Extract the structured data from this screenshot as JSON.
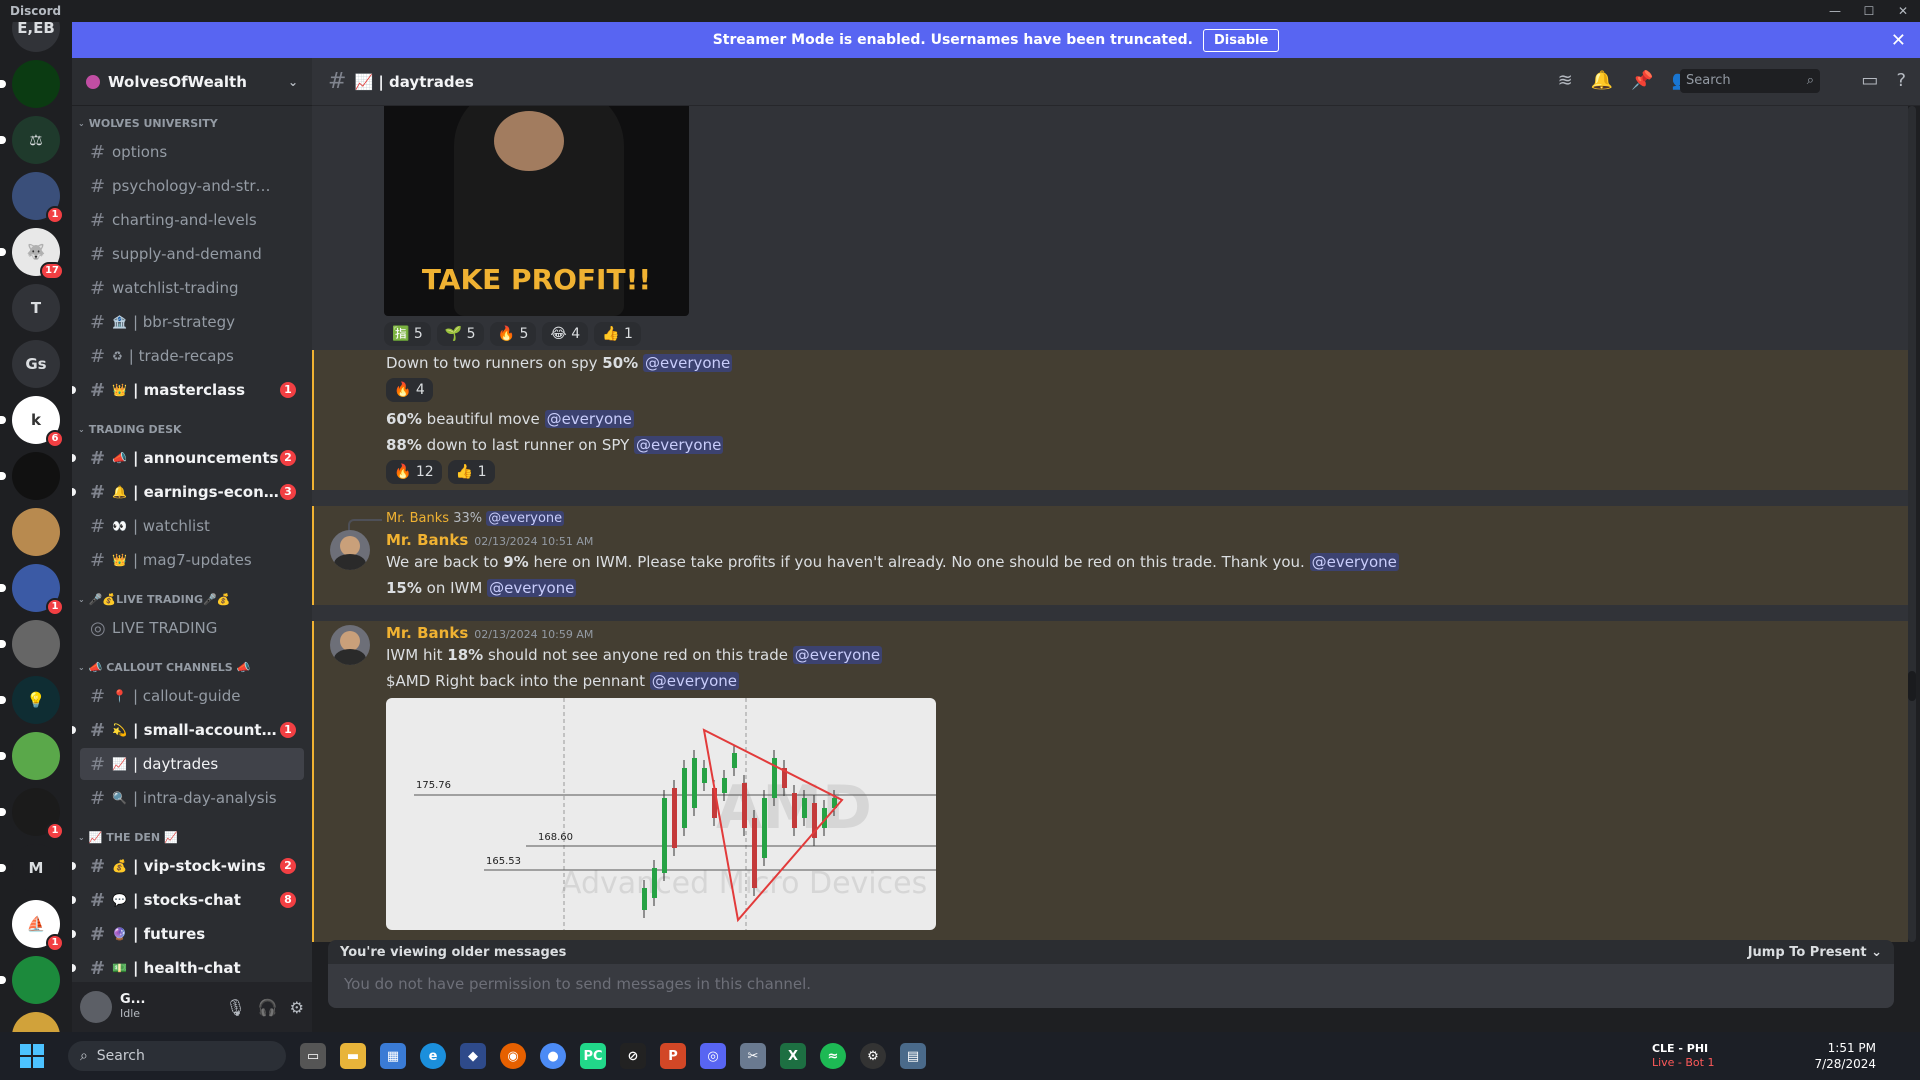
{
  "titlebar": {
    "app": "Discord",
    "minimize": "—",
    "maximize": "☐",
    "close": "✕"
  },
  "servers": [
    {
      "label": "E,EB",
      "color": "#313338",
      "pill": false,
      "count": ""
    },
    {
      "label": "",
      "color": "#0b3b12",
      "pill": true,
      "count": ""
    },
    {
      "label": "⚖",
      "color": "#1f3a2c",
      "pill": true,
      "count": ""
    },
    {
      "label": "",
      "color": "#3a4f7a",
      "pill": false,
      "count": "1"
    },
    {
      "label": "🐺",
      "color": "#e8e8e8",
      "pill": true,
      "count": "17"
    },
    {
      "label": "T",
      "color": "#313338",
      "pill": false,
      "count": ""
    },
    {
      "label": "Gs",
      "color": "#313338",
      "pill": false,
      "count": ""
    },
    {
      "label": "k",
      "color": "#ffffff",
      "pill": true,
      "count": "6"
    },
    {
      "label": "",
      "color": "#111111",
      "pill": true,
      "count": ""
    },
    {
      "label": "",
      "color": "#b88a4f",
      "pill": false,
      "count": ""
    },
    {
      "label": "",
      "color": "#3b5aa5",
      "pill": true,
      "count": "1"
    },
    {
      "label": "",
      "color": "#666666",
      "pill": true,
      "count": ""
    },
    {
      "label": "💡",
      "color": "#0f2d33",
      "pill": true,
      "count": ""
    },
    {
      "label": "",
      "color": "#5aa84a",
      "pill": true,
      "count": ""
    },
    {
      "label": "",
      "color": "#1b1b1b",
      "pill": true,
      "count": "1"
    },
    {
      "label": "M",
      "color": "#1e1f22",
      "pill": true,
      "count": ""
    },
    {
      "label": "⛵",
      "color": "#ffffff",
      "pill": false,
      "count": "1"
    },
    {
      "label": "",
      "color": "#1c8a3c",
      "pill": true,
      "count": ""
    },
    {
      "label": "",
      "color": "#d1a23a",
      "pill": false,
      "count": ""
    }
  ],
  "banner": {
    "text": "Streamer Mode is enabled. Usernames have been truncated.",
    "button": "Disable",
    "close": "✕"
  },
  "guild": {
    "name": "WolvesOfWealth",
    "chevron": "⌄"
  },
  "categories": [
    {
      "name": "WOLVES UNIVERSITY",
      "channels": [
        {
          "emoji": "",
          "label": "options",
          "unread": false,
          "active": false,
          "mention": ""
        },
        {
          "emoji": "",
          "label": "psychology-and-strategi...",
          "unread": false,
          "active": false,
          "mention": ""
        },
        {
          "emoji": "",
          "label": "charting-and-levels",
          "unread": false,
          "active": false,
          "mention": ""
        },
        {
          "emoji": "",
          "label": "supply-and-demand",
          "unread": false,
          "active": false,
          "mention": ""
        },
        {
          "emoji": "",
          "label": "watchlist-trading",
          "unread": false,
          "active": false,
          "mention": ""
        },
        {
          "emoji": "🏦",
          "label": "| bbr-strategy",
          "unread": false,
          "active": false,
          "mention": ""
        },
        {
          "emoji": "♻",
          "label": "| trade-recaps",
          "unread": false,
          "active": false,
          "mention": ""
        },
        {
          "emoji": "👑",
          "label": "| masterclass",
          "unread": true,
          "active": false,
          "mention": "1"
        }
      ]
    },
    {
      "name": "TRADING DESK",
      "channels": [
        {
          "emoji": "📣",
          "label": "| announcements",
          "unread": true,
          "active": false,
          "mention": "2"
        },
        {
          "emoji": "🔔",
          "label": "| earnings-econo...",
          "unread": true,
          "active": false,
          "mention": "3"
        },
        {
          "emoji": "👀",
          "label": "| watchlist",
          "unread": false,
          "active": false,
          "mention": ""
        },
        {
          "emoji": "👑",
          "label": "| mag7-updates",
          "unread": false,
          "active": false,
          "mention": ""
        }
      ]
    },
    {
      "name": "🎤💰LIVE TRADING🎤💰",
      "channels": [
        {
          "emoji": "",
          "label": "LIVE TRADING",
          "unread": false,
          "active": false,
          "mention": "",
          "voice": true
        }
      ]
    },
    {
      "name": "📣 CALLOUT CHANNELS 📣",
      "channels": [
        {
          "emoji": "📍",
          "label": "| callout-guide",
          "unread": false,
          "active": false,
          "mention": ""
        },
        {
          "emoji": "💫",
          "label": "| small-account-...",
          "unread": true,
          "active": false,
          "mention": "1"
        },
        {
          "emoji": "📈",
          "label": "| daytrades",
          "unread": false,
          "active": true,
          "mention": ""
        },
        {
          "emoji": "🔍",
          "label": "| intra-day-analysis",
          "unread": false,
          "active": false,
          "mention": ""
        }
      ]
    },
    {
      "name": "📈 THE DEN 📈",
      "channels": [
        {
          "emoji": "💰",
          "label": "| vip-stock-wins",
          "unread": true,
          "active": false,
          "mention": "2"
        },
        {
          "emoji": "💬",
          "label": "| stocks-chat",
          "unread": true,
          "active": false,
          "mention": "8"
        },
        {
          "emoji": "🔮",
          "label": "| futures",
          "unread": true,
          "active": false,
          "mention": ""
        },
        {
          "emoji": "💵",
          "label": "| health-chat",
          "unread": true,
          "active": false,
          "mention": ""
        }
      ]
    }
  ],
  "user": {
    "name": "G...",
    "status": "Idle"
  },
  "header": {
    "channel": "📈 | daytrades",
    "search_placeholder": "Search"
  },
  "messages": {
    "gif_caption": "TAKE PROFIT!!",
    "gif_reactions": [
      "🈯 5",
      "🌱 5",
      "🔥 5",
      "😂 4",
      "👍 1"
    ],
    "m1": {
      "pre": "Down to two runners on spy ",
      "bold": "50%",
      "mention": "@everyone"
    },
    "m1_reactions": [
      "🔥 4"
    ],
    "m2": {
      "bold": "60%",
      "rest": " beautiful move ",
      "mention": "@everyone"
    },
    "m3": {
      "bold": "88%",
      "rest": " down to last runner on SPY ",
      "mention": "@everyone"
    },
    "m3_reactions": [
      "🔥 12",
      "👍 1"
    ],
    "reply": {
      "author": "Mr. Banks",
      "text": "33%",
      "mention": "@everyone"
    },
    "m4": {
      "author": "Mr. Banks",
      "time": "02/13/2024 10:51 AM",
      "pre": "We are back to ",
      "bold": "9%",
      "rest": " here on IWM. Please take profits if you haven't already. No one should be red on this trade. Thank you. ",
      "mention": "@everyone"
    },
    "m5": {
      "bold": "15%",
      "rest": " on IWM ",
      "mention": "@everyone"
    },
    "m6": {
      "author": "Mr. Banks",
      "time": "02/13/2024 10:59 AM",
      "pre": "IWM hit ",
      "bold": "18%",
      "rest": " should not see anyone red on this trade ",
      "mention": "@everyone"
    },
    "m7": {
      "text": "$AMD Right back into the pennant ",
      "mention": "@everyone"
    },
    "chart_levels": [
      "175.76",
      "168.60",
      "165.53"
    ],
    "chart_watermark": "AMD",
    "chart_watermark2": "Advanced Micro Devices"
  },
  "footer": {
    "older": "You're viewing older messages",
    "jump": "Jump To Present",
    "no_permission": "You do not have permission to send messages in this channel."
  },
  "taskbar": {
    "search": "Search",
    "game_line1": "CLE - PHI",
    "game_line2": "Live - Bot 1",
    "time": "1:51 PM",
    "date": "7/28/2024"
  },
  "colors": {
    "blurple": "#5865f2",
    "highlight": "#443e32",
    "author": "#f0b232"
  }
}
